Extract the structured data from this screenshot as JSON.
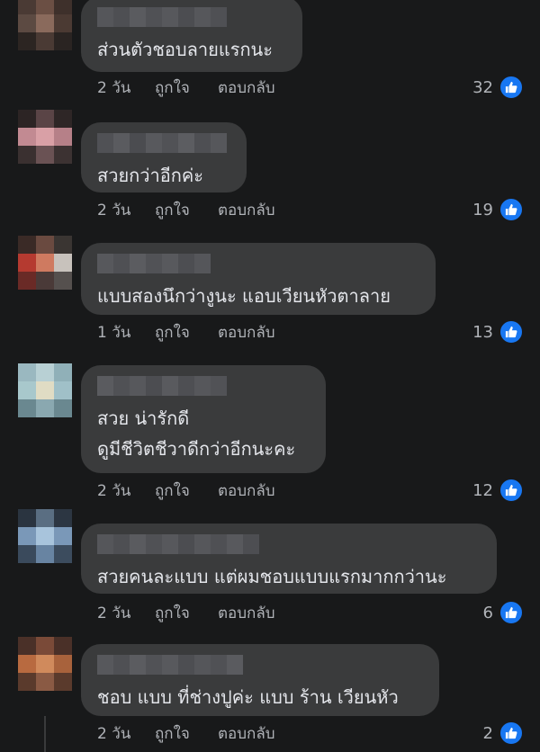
{
  "actions": {
    "like_label": "ถูกใจ",
    "reply_label": "ตอบกลับ"
  },
  "colors": {
    "background": "#18191a",
    "bubble": "#3a3b3c",
    "text": "#e4e6eb",
    "meta": "#b0b3b8",
    "like_accent": "#1877f2"
  },
  "comments": [
    {
      "lines": [
        "ส่วนตัวชอบลายแรกนะ"
      ],
      "age": "2 วัน",
      "like_count": "32",
      "reaction_icon": "thumbs-up-icon"
    },
    {
      "lines": [
        "สวยกว่าอีกค่ะ"
      ],
      "age": "2 วัน",
      "like_count": "19",
      "reaction_icon": "thumbs-up-icon"
    },
    {
      "lines": [
        "แบบสองนึกว่างูนะ แอบเวียนหัวตาลาย"
      ],
      "age": "1 วัน",
      "like_count": "13",
      "reaction_icon": "thumbs-up-icon"
    },
    {
      "lines": [
        "สวย  น่ารักดี",
        "ดูมีชีวิตชีวาดีกว่าอีกนะคะ"
      ],
      "age": "2 วัน",
      "like_count": "12",
      "reaction_icon": "thumbs-up-icon"
    },
    {
      "lines": [
        "สวยคนละแบบ แต่ผมชอบแบบแรกมากกว่านะ"
      ],
      "age": "2 วัน",
      "like_count": "6",
      "reaction_icon": "thumbs-up-icon"
    },
    {
      "lines": [
        "ชอบ แบบ ที่ช่างปูค่ะ แบบ ร้าน เวียนหัว"
      ],
      "age": "2 วัน",
      "like_count": "2",
      "reaction_icon": "thumbs-up-icon"
    }
  ]
}
